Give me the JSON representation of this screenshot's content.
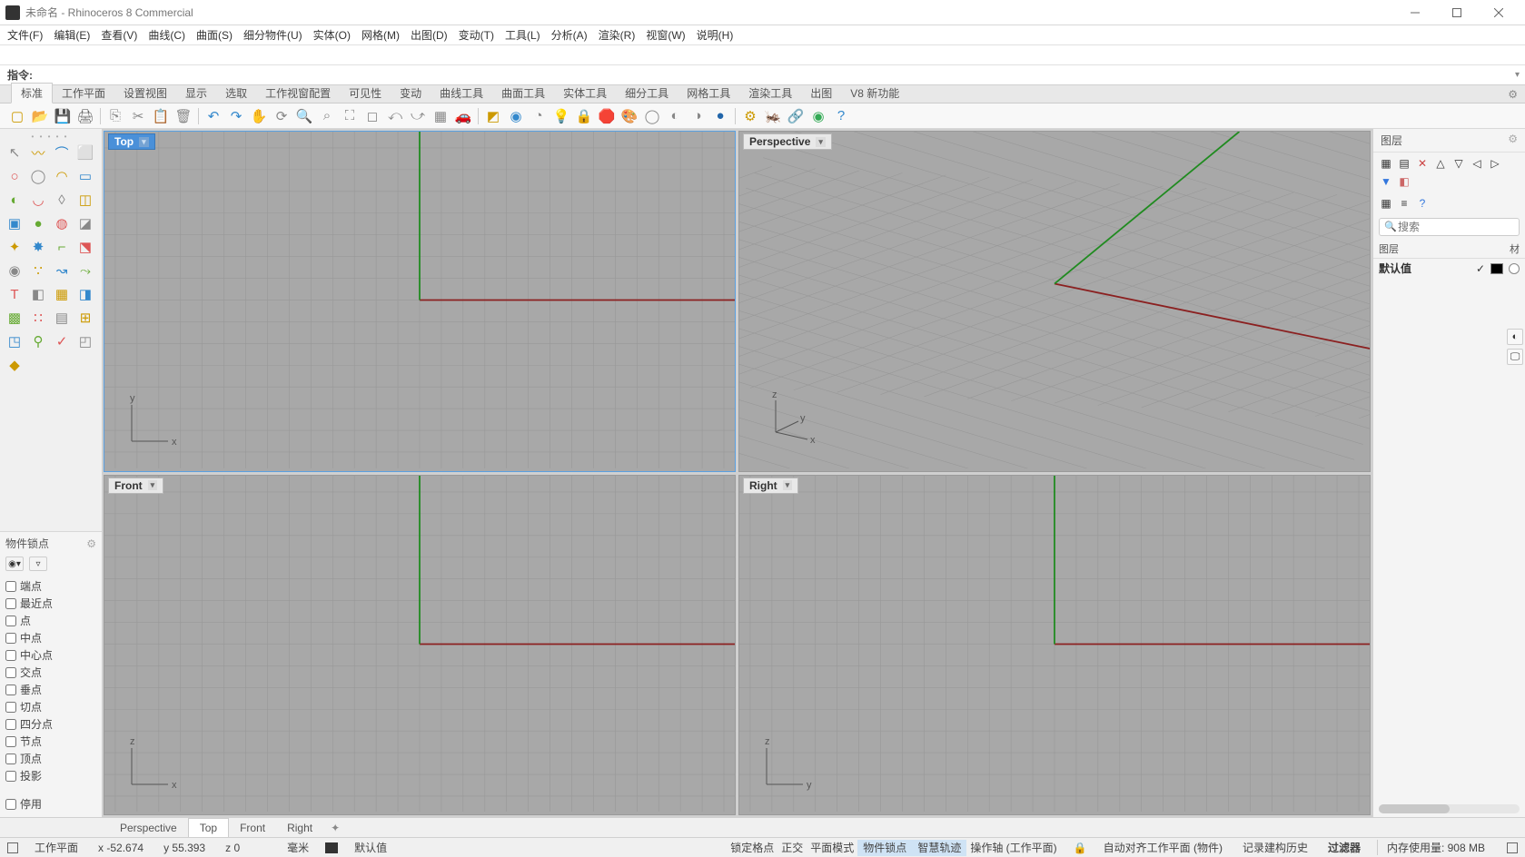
{
  "window": {
    "title": "未命名 - Rhinoceros 8 Commercial"
  },
  "menu": [
    "文件(F)",
    "编辑(E)",
    "查看(V)",
    "曲线(C)",
    "曲面(S)",
    "细分物件(U)",
    "实体(O)",
    "网格(M)",
    "出图(D)",
    "变动(T)",
    "工具(L)",
    "分析(A)",
    "渲染(R)",
    "视窗(W)",
    "说明(H)"
  ],
  "command": {
    "label": "指令:"
  },
  "tabs": [
    "标准",
    "工作平面",
    "设置视图",
    "显示",
    "选取",
    "工作视窗配置",
    "可见性",
    "变动",
    "曲线工具",
    "曲面工具",
    "实体工具",
    "细分工具",
    "网格工具",
    "渲染工具",
    "出图",
    "V8 新功能"
  ],
  "tabs_active": 0,
  "viewports": {
    "tl": {
      "name": "Top",
      "active": true,
      "axes": [
        "x",
        "y"
      ]
    },
    "tr": {
      "name": "Perspective",
      "active": false,
      "axes": [
        "x",
        "y",
        "z"
      ]
    },
    "bl": {
      "name": "Front",
      "active": false,
      "axes": [
        "x",
        "z"
      ]
    },
    "br": {
      "name": "Right",
      "active": false,
      "axes": [
        "y",
        "z"
      ]
    }
  },
  "osnap": {
    "title": "物件锁点",
    "items": [
      "端点",
      "最近点",
      "点",
      "中点",
      "中心点",
      "交点",
      "垂点",
      "切点",
      "四分点",
      "节点",
      "顶点",
      "投影"
    ],
    "disable": "停用"
  },
  "layers": {
    "title": "图层",
    "search_ph": "搜索",
    "col1": "图层",
    "col2": "材",
    "default_name": "默认值"
  },
  "viewtabs": [
    "Perspective",
    "Top",
    "Front",
    "Right"
  ],
  "viewtabs_active": 1,
  "status": {
    "cplane": "工作平面",
    "x": "x -52.674",
    "y": "y 55.393",
    "z": "z 0",
    "unit": "毫米",
    "layer": "默认值",
    "items": [
      "锁定格点",
      "正交",
      "平面模式",
      "物件锁点",
      "智慧轨迹",
      "操作轴 (工作平面)"
    ],
    "active_idx": [
      3,
      4
    ],
    "autoalign": "自动对齐工作平面 (物件)",
    "history": "记录建构历史",
    "filter": "过滤器",
    "mem": "内存使用量: 908 MB"
  }
}
